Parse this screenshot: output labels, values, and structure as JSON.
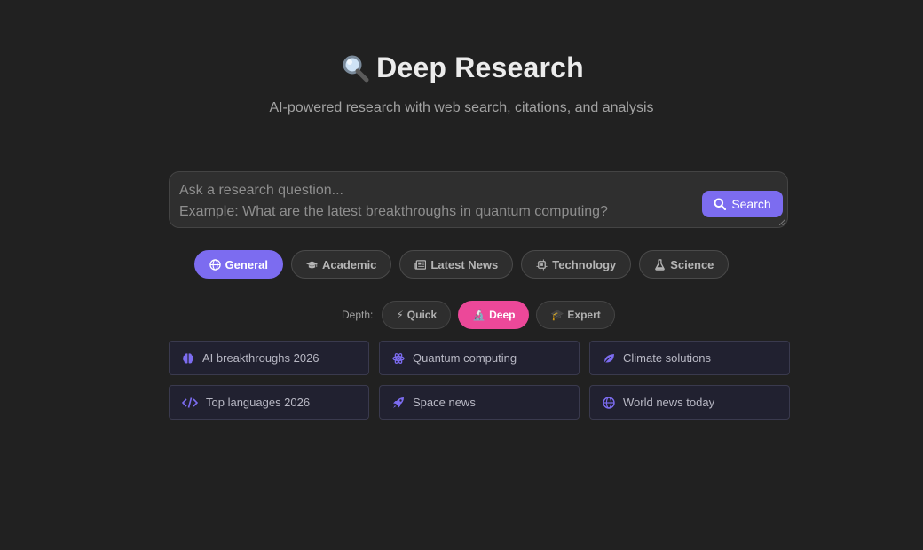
{
  "header": {
    "title": "Deep Research",
    "subtitle": "AI-powered research with web search, citations, and analysis"
  },
  "search": {
    "placeholder": "Ask a research question...\nExample: What are the latest breakthroughs in quantum computing?",
    "button_label": "Search"
  },
  "modes": [
    {
      "label": "General",
      "icon": "globe-icon",
      "active": true
    },
    {
      "label": "Academic",
      "icon": "graduation-cap-icon",
      "active": false
    },
    {
      "label": "Latest News",
      "icon": "newspaper-icon",
      "active": false
    },
    {
      "label": "Technology",
      "icon": "chip-icon",
      "active": false
    },
    {
      "label": "Science",
      "icon": "flask-icon",
      "active": false
    }
  ],
  "depth": {
    "label": "Depth:",
    "options": [
      {
        "label": "Quick",
        "emoji": "⚡",
        "active": false
      },
      {
        "label": "Deep",
        "emoji": "🔬",
        "active": true
      },
      {
        "label": "Expert",
        "emoji": "🎓",
        "active": false
      }
    ]
  },
  "suggestions": [
    {
      "label": "AI breakthroughs 2026",
      "icon": "brain-icon"
    },
    {
      "label": "Quantum computing",
      "icon": "atom-icon"
    },
    {
      "label": "Climate solutions",
      "icon": "leaf-icon"
    },
    {
      "label": "Top languages 2026",
      "icon": "code-icon"
    },
    {
      "label": "Space news",
      "icon": "rocket-icon"
    },
    {
      "label": "World news today",
      "icon": "globe-icon"
    }
  ],
  "colors": {
    "background": "#212121",
    "accent": "#7c6cf0",
    "depth_active": "#ec4899"
  }
}
